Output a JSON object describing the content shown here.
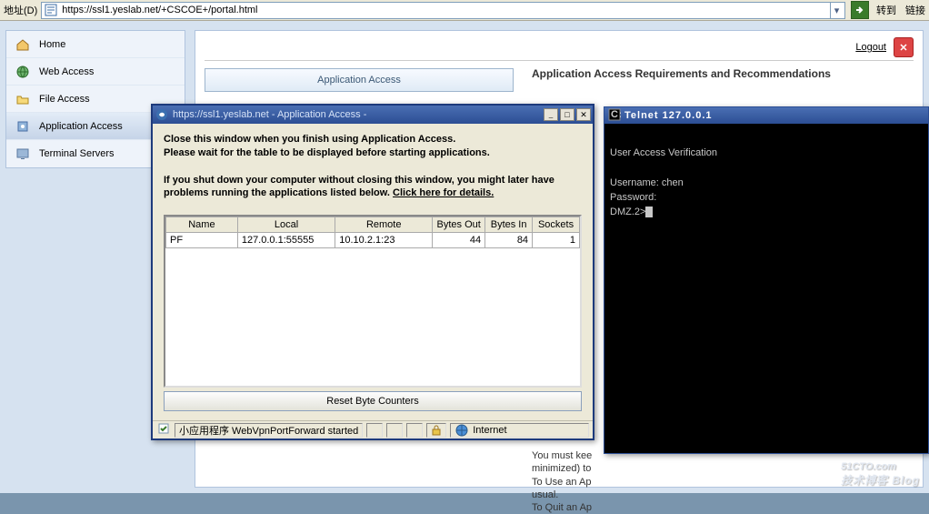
{
  "addrbar": {
    "label": "地址(D)",
    "url": "https://ssl1.yeslab.net/+CSCOE+/portal.html",
    "go": "转到",
    "links": "链接"
  },
  "sidebar": {
    "items": [
      {
        "label": "Home"
      },
      {
        "label": "Web Access"
      },
      {
        "label": "File Access"
      },
      {
        "label": "Application Access"
      },
      {
        "label": "Terminal Servers"
      }
    ]
  },
  "header": {
    "logout": "Logout"
  },
  "tabs": {
    "app_access": "Application Access"
  },
  "rightcol": {
    "title": "Application Access Requirements and Recommendations",
    "bodylines": [
      "You must kee",
      "minimized) to",
      "To Use an Ap",
      "usual.",
      "To Quit an Ap"
    ]
  },
  "appwin": {
    "title": "https://ssl1.yeslab.net - Application Access -",
    "instr1": "Close this window when you finish using Application Access.",
    "instr2": "Please wait for the table to be displayed before starting applications.",
    "instr3a": "If you shut down your computer without closing this window, you might later have",
    "instr3b": "problems running the applications listed below. ",
    "instr3_link": "Click here for details.",
    "table": {
      "headers": [
        "Name",
        "Local",
        "Remote",
        "Bytes Out",
        "Bytes In",
        "Sockets"
      ],
      "row": {
        "name": "PF",
        "local": "127.0.0.1:55555",
        "remote": "10.10.2.1:23",
        "out": "44",
        "in": "84",
        "sock": "1"
      }
    },
    "reset": "Reset Byte Counters",
    "status_left": "小应用程序 WebVpnPortForward started",
    "status_right": "Internet"
  },
  "telnet": {
    "title": "Telnet 127.0.0.1",
    "lines": "\nUser Access Verification\n\nUsername: chen\nPassword:\nDMZ.2>"
  },
  "watermark": {
    "main": "51CTO.com",
    "sub": "技术博客   Blog"
  }
}
